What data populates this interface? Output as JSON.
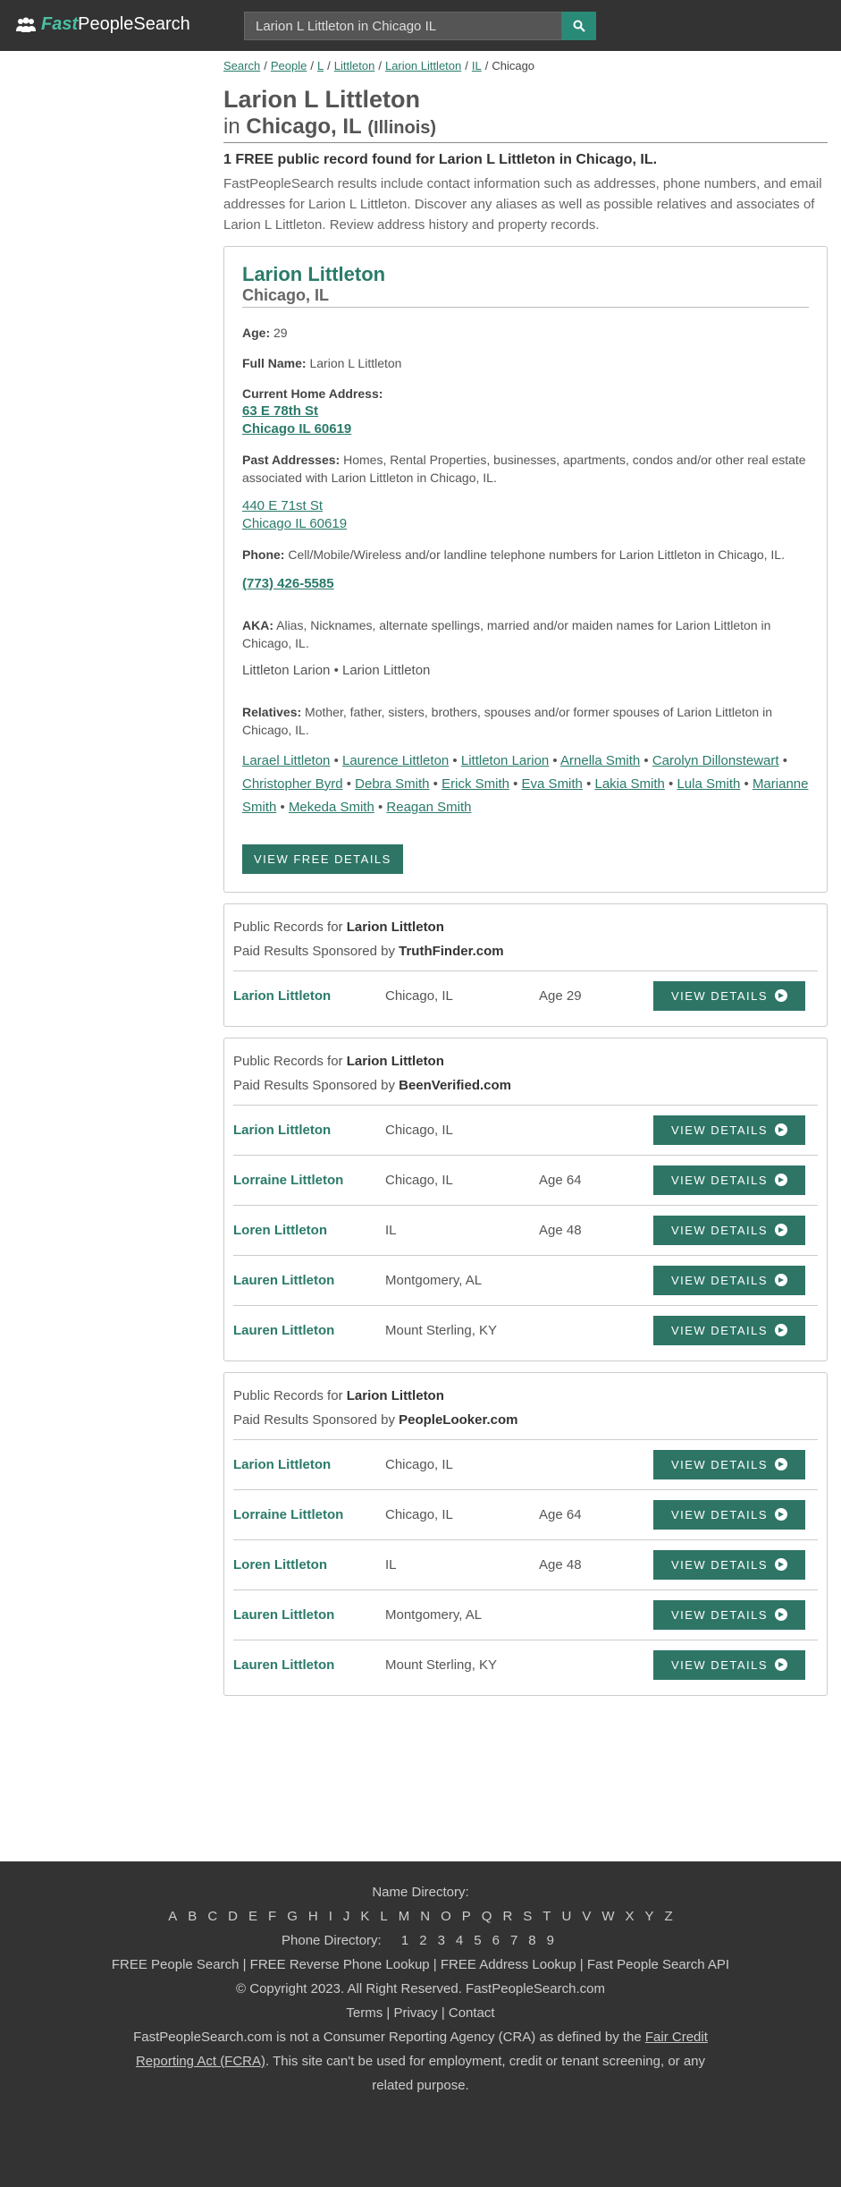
{
  "header": {
    "logo_fast": "Fast",
    "logo_rest": "PeopleSearch",
    "search_value": "Larion L Littleton in Chicago IL"
  },
  "breadcrumb": [
    "Search",
    "People",
    "L",
    "Littleton",
    "Larion Littleton",
    "IL",
    "Chicago"
  ],
  "title": {
    "name": "Larion L Littleton",
    "in": "in",
    "city": "Chicago, IL",
    "state": "(Illinois)"
  },
  "found_text": "1 FREE public record found for Larion L Littleton in Chicago, IL.",
  "intro_text": "FastPeopleSearch results include contact information such as addresses, phone numbers, and email addresses for Larion L Littleton. Discover any aliases as well as possible relatives and associates of Larion L Littleton. Review address history and property records.",
  "card": {
    "name": "Larion Littleton",
    "location": "Chicago, IL",
    "age_label": "Age:",
    "age": "29",
    "fullname_label": "Full Name:",
    "fullname": "Larion L Littleton",
    "current_label": "Current Home Address:",
    "current_line1": "63 E 78th St",
    "current_line2": "Chicago IL 60619",
    "past_label": "Past Addresses:",
    "past_desc": "Homes, Rental Properties, businesses, apartments, condos and/or other real estate associated with Larion Littleton in Chicago, IL.",
    "past_line1": "440 E 71st St",
    "past_line2": "Chicago IL 60619",
    "phone_label": "Phone:",
    "phone_desc": "Cell/Mobile/Wireless and/or landline telephone numbers for Larion Littleton in Chicago, IL.",
    "phone": "(773) 426-5585",
    "aka_label": "AKA:",
    "aka_desc": "Alias, Nicknames, alternate spellings, married and/or maiden names for Larion Littleton in Chicago, IL.",
    "aka_values": "Littleton Larion • Larion Littleton",
    "relatives_label": "Relatives:",
    "relatives_desc": "Mother, father, sisters, brothers, spouses and/or former spouses of Larion Littleton in Chicago, IL.",
    "relatives": [
      "Larael Littleton",
      "Laurence Littleton",
      "Littleton Larion",
      "Arnella Smith",
      "Carolyn Dillonstewart",
      "Christopher Byrd",
      "Debra Smith",
      "Erick Smith",
      "Eva Smith",
      "Lakia Smith",
      "Lula Smith",
      "Marianne Smith",
      "Mekeda Smith",
      "Reagan Smith"
    ],
    "button": "VIEW FREE DETAILS"
  },
  "sponsors": [
    {
      "public_prefix": "Public Records for",
      "public_name": "Larion Littleton",
      "paid_prefix": "Paid Results Sponsored by",
      "sponsor": "TruthFinder.com",
      "rows": [
        {
          "name": "Larion Littleton",
          "loc": "Chicago, IL",
          "age": "Age 29"
        }
      ]
    },
    {
      "public_prefix": "Public Records for",
      "public_name": "Larion Littleton",
      "paid_prefix": "Paid Results Sponsored by",
      "sponsor": "BeenVerified.com",
      "rows": [
        {
          "name": "Larion Littleton",
          "loc": "Chicago, IL",
          "age": ""
        },
        {
          "name": "Lorraine Littleton",
          "loc": "Chicago, IL",
          "age": "Age 64"
        },
        {
          "name": "Loren Littleton",
          "loc": "IL",
          "age": "Age 48"
        },
        {
          "name": "Lauren Littleton",
          "loc": "Montgomery, AL",
          "age": ""
        },
        {
          "name": "Lauren Littleton",
          "loc": "Mount Sterling, KY",
          "age": ""
        }
      ]
    },
    {
      "public_prefix": "Public Records for",
      "public_name": "Larion Littleton",
      "paid_prefix": "Paid Results Sponsored by",
      "sponsor": "PeopleLooker.com",
      "rows": [
        {
          "name": "Larion Littleton",
          "loc": "Chicago, IL",
          "age": ""
        },
        {
          "name": "Lorraine Littleton",
          "loc": "Chicago, IL",
          "age": "Age 64"
        },
        {
          "name": "Loren Littleton",
          "loc": "IL",
          "age": "Age 48"
        },
        {
          "name": "Lauren Littleton",
          "loc": "Montgomery, AL",
          "age": ""
        },
        {
          "name": "Lauren Littleton",
          "loc": "Mount Sterling, KY",
          "age": ""
        }
      ]
    }
  ],
  "view_details_label": "VIEW DETAILS",
  "footer": {
    "name_directory": "Name Directory:",
    "letters": [
      "A",
      "B",
      "C",
      "D",
      "E",
      "F",
      "G",
      "H",
      "I",
      "J",
      "K",
      "L",
      "M",
      "N",
      "O",
      "P",
      "Q",
      "R",
      "S",
      "T",
      "U",
      "V",
      "W",
      "X",
      "Y",
      "Z"
    ],
    "phone_directory": "Phone Directory:",
    "digits": [
      "1",
      "2",
      "3",
      "4",
      "5",
      "6",
      "7",
      "8",
      "9"
    ],
    "links_line": "FREE People Search | FREE Reverse Phone Lookup | FREE Address Lookup | Fast People Search API",
    "copyright": "© Copyright 2023. All Right Reserved. FastPeopleSearch.com",
    "legal_line": "Terms | Privacy | Contact",
    "cra_prefix": "FastPeopleSearch.com is not a Consumer Reporting Agency (CRA) as defined by the",
    "cra_link": "Fair Credit Reporting Act (FCRA)",
    "cra_suffix": ". This site can't be used for employment, credit or tenant screening, or any related purpose."
  },
  "colors": {
    "header_bg": "#333333",
    "accent": "#2e7566",
    "logo_fast": "#49c0a3"
  }
}
